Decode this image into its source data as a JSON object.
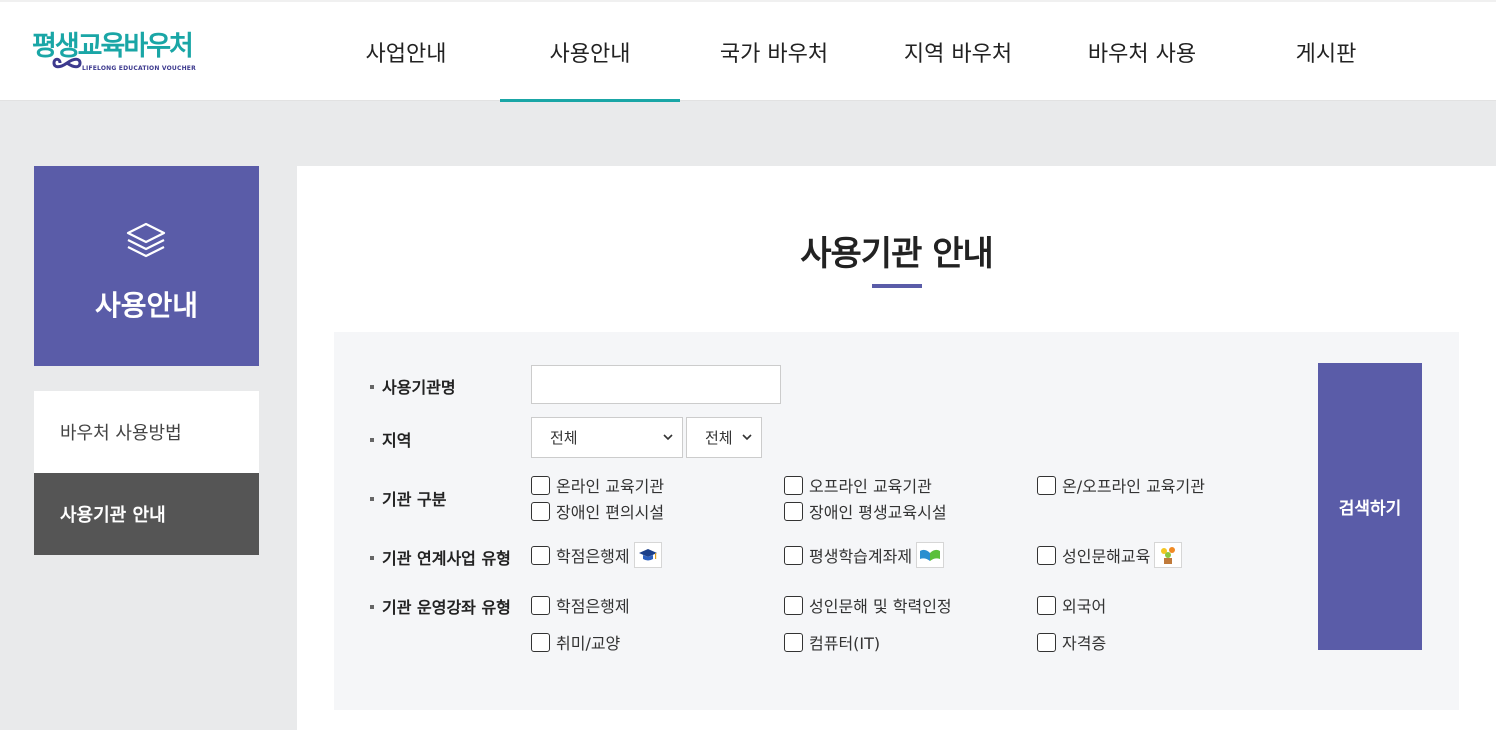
{
  "header": {
    "logo_text": "평생교육바우처",
    "logo_sub": "LIFELONG EDUCATION VOUCHER",
    "nav": [
      {
        "label": "사업안내"
      },
      {
        "label": "사용안내"
      },
      {
        "label": "국가 바우처"
      },
      {
        "label": "지역 바우처"
      },
      {
        "label": "바우처 사용"
      },
      {
        "label": "게시판"
      }
    ],
    "active_nav": "사용안내"
  },
  "sidebar": {
    "title": "사용안내",
    "icon": "layers-icon",
    "items": [
      {
        "label": "바우처 사용방법"
      },
      {
        "label": "사용기관 안내"
      }
    ],
    "active_item": "사용기관 안내"
  },
  "main": {
    "title": "사용기관 안내",
    "search": {
      "labels": {
        "name": "사용기관명",
        "region": "지역",
        "category": "기관 구분",
        "program": "기관 연계사업 유형",
        "course": "기관 운영강좌 유형"
      },
      "name_value": "",
      "region_primary": "전체",
      "region_secondary": "전체",
      "category_options": [
        "온라인 교육기관",
        "오프라인 교육기관",
        "온/오프라인 교육기관",
        "장애인 편의시설",
        "장애인 평생교육시설"
      ],
      "program_options": [
        "학점은행제",
        "평생학습계좌제",
        "성인문해교육"
      ],
      "program_icons": [
        "graduation-cap-icon",
        "open-book-icon",
        "flower-pot-icon"
      ],
      "course_options": [
        "학점은행제",
        "성인문해 및 학력인정",
        "외국어",
        "취미/교양",
        "컴퓨터(IT)",
        "자격증"
      ],
      "button_label": "검색하기"
    }
  },
  "colors": {
    "accent": "#5a5ca8",
    "teal": "#1aa6a6",
    "dark_side": "#555555"
  }
}
